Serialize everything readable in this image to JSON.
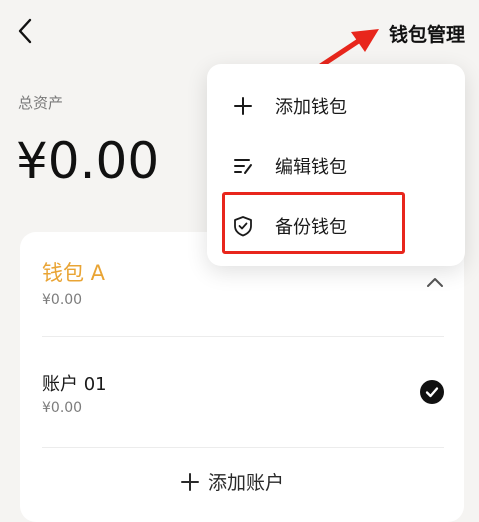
{
  "header": {
    "back_icon": "chevron-left-icon",
    "title": "钱包管理"
  },
  "summary": {
    "label": "总资产",
    "amount": "¥0.00"
  },
  "wallet": {
    "name": "钱包 A",
    "amount": "¥0.00",
    "expanded": true,
    "accounts": [
      {
        "name": "账户 01",
        "amount": "¥0.00",
        "selected": true
      }
    ],
    "add_account_label": "添加账户"
  },
  "dropdown_menu": {
    "items": [
      {
        "label": "添加钱包",
        "icon": "plus-icon"
      },
      {
        "label": "编辑钱包",
        "icon": "edit-list-icon"
      },
      {
        "label": "备份钱包",
        "icon": "shield-check-icon"
      }
    ],
    "highlighted_item": "备份钱包"
  },
  "annotation_colors": {
    "arrow": "#e8261c",
    "highlight_box": "#e8261c",
    "wallet_name": "#e9a434"
  }
}
